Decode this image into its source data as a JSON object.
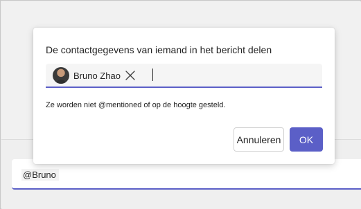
{
  "dialog": {
    "title": "De contactgegevens van iemand in het bericht delen",
    "hint": "Ze worden niet @mentioned of op de hoogte gesteld.",
    "picker": {
      "selected": [
        {
          "name": "Bruno Zhao",
          "avatar_icon": "person-avatar",
          "remove_icon": "close-icon"
        }
      ],
      "value": ""
    },
    "buttons": {
      "cancel_label": "Annuleren",
      "ok_label": "OK"
    }
  },
  "compose": {
    "text": "@Bruno"
  },
  "colors": {
    "accent": "#5b5fc7",
    "text": "#242424",
    "backdrop": "#ebebeb"
  }
}
